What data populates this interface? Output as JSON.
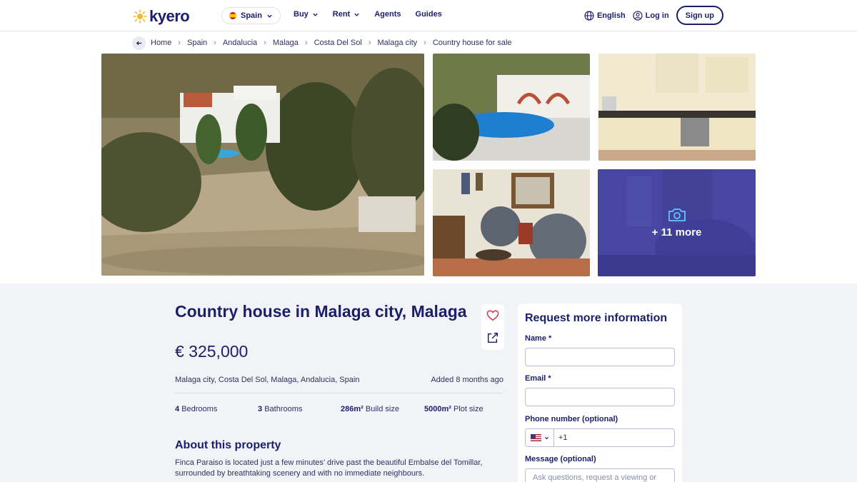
{
  "header": {
    "logo_text": "kyero",
    "country": "Spain",
    "nav": [
      "Buy",
      "Rent",
      "Agents",
      "Guides"
    ],
    "language": "English",
    "login": "Log in",
    "signup": "Sign up"
  },
  "breadcrumb": [
    "Home",
    "Spain",
    "Andalucia",
    "Malaga",
    "Costa Del Sol",
    "Malaga city",
    "Country house for sale"
  ],
  "gallery": {
    "more_label": "+ 11 more"
  },
  "listing": {
    "title": "Country house in Malaga city, Malaga",
    "price": "€ 325,000",
    "location": "Malaga city, Costa Del Sol, Malaga, Andalucia, Spain",
    "added": "Added 8 months ago",
    "stats": [
      {
        "value": "4",
        "label": "Bedrooms"
      },
      {
        "value": "3",
        "label": "Bathrooms"
      },
      {
        "value": "286m²",
        "label": "Build size"
      },
      {
        "value": "5000m²",
        "label": "Plot size"
      }
    ],
    "about_heading": "About this property",
    "about_text": "Finca Paraiso is located just a few minutes’ drive past the beautiful Embalse del Tomillar, surrounded by breathtaking scenery and with no immediate neighbours."
  },
  "form": {
    "heading": "Request more information",
    "name_label": "Name *",
    "email_label": "Email *",
    "phone_label": "Phone number (optional)",
    "dial_code": "+1",
    "message_label": "Message (optional)",
    "message_placeholder": "Ask questions, request a viewing or"
  },
  "colors": {
    "brand_navy": "#1b1f6b",
    "logo_sun": "#f5b82e",
    "favorite_red": "#e0334a",
    "overlay_blue": "#2a2db8",
    "content_bg": "#f2f3f7"
  }
}
